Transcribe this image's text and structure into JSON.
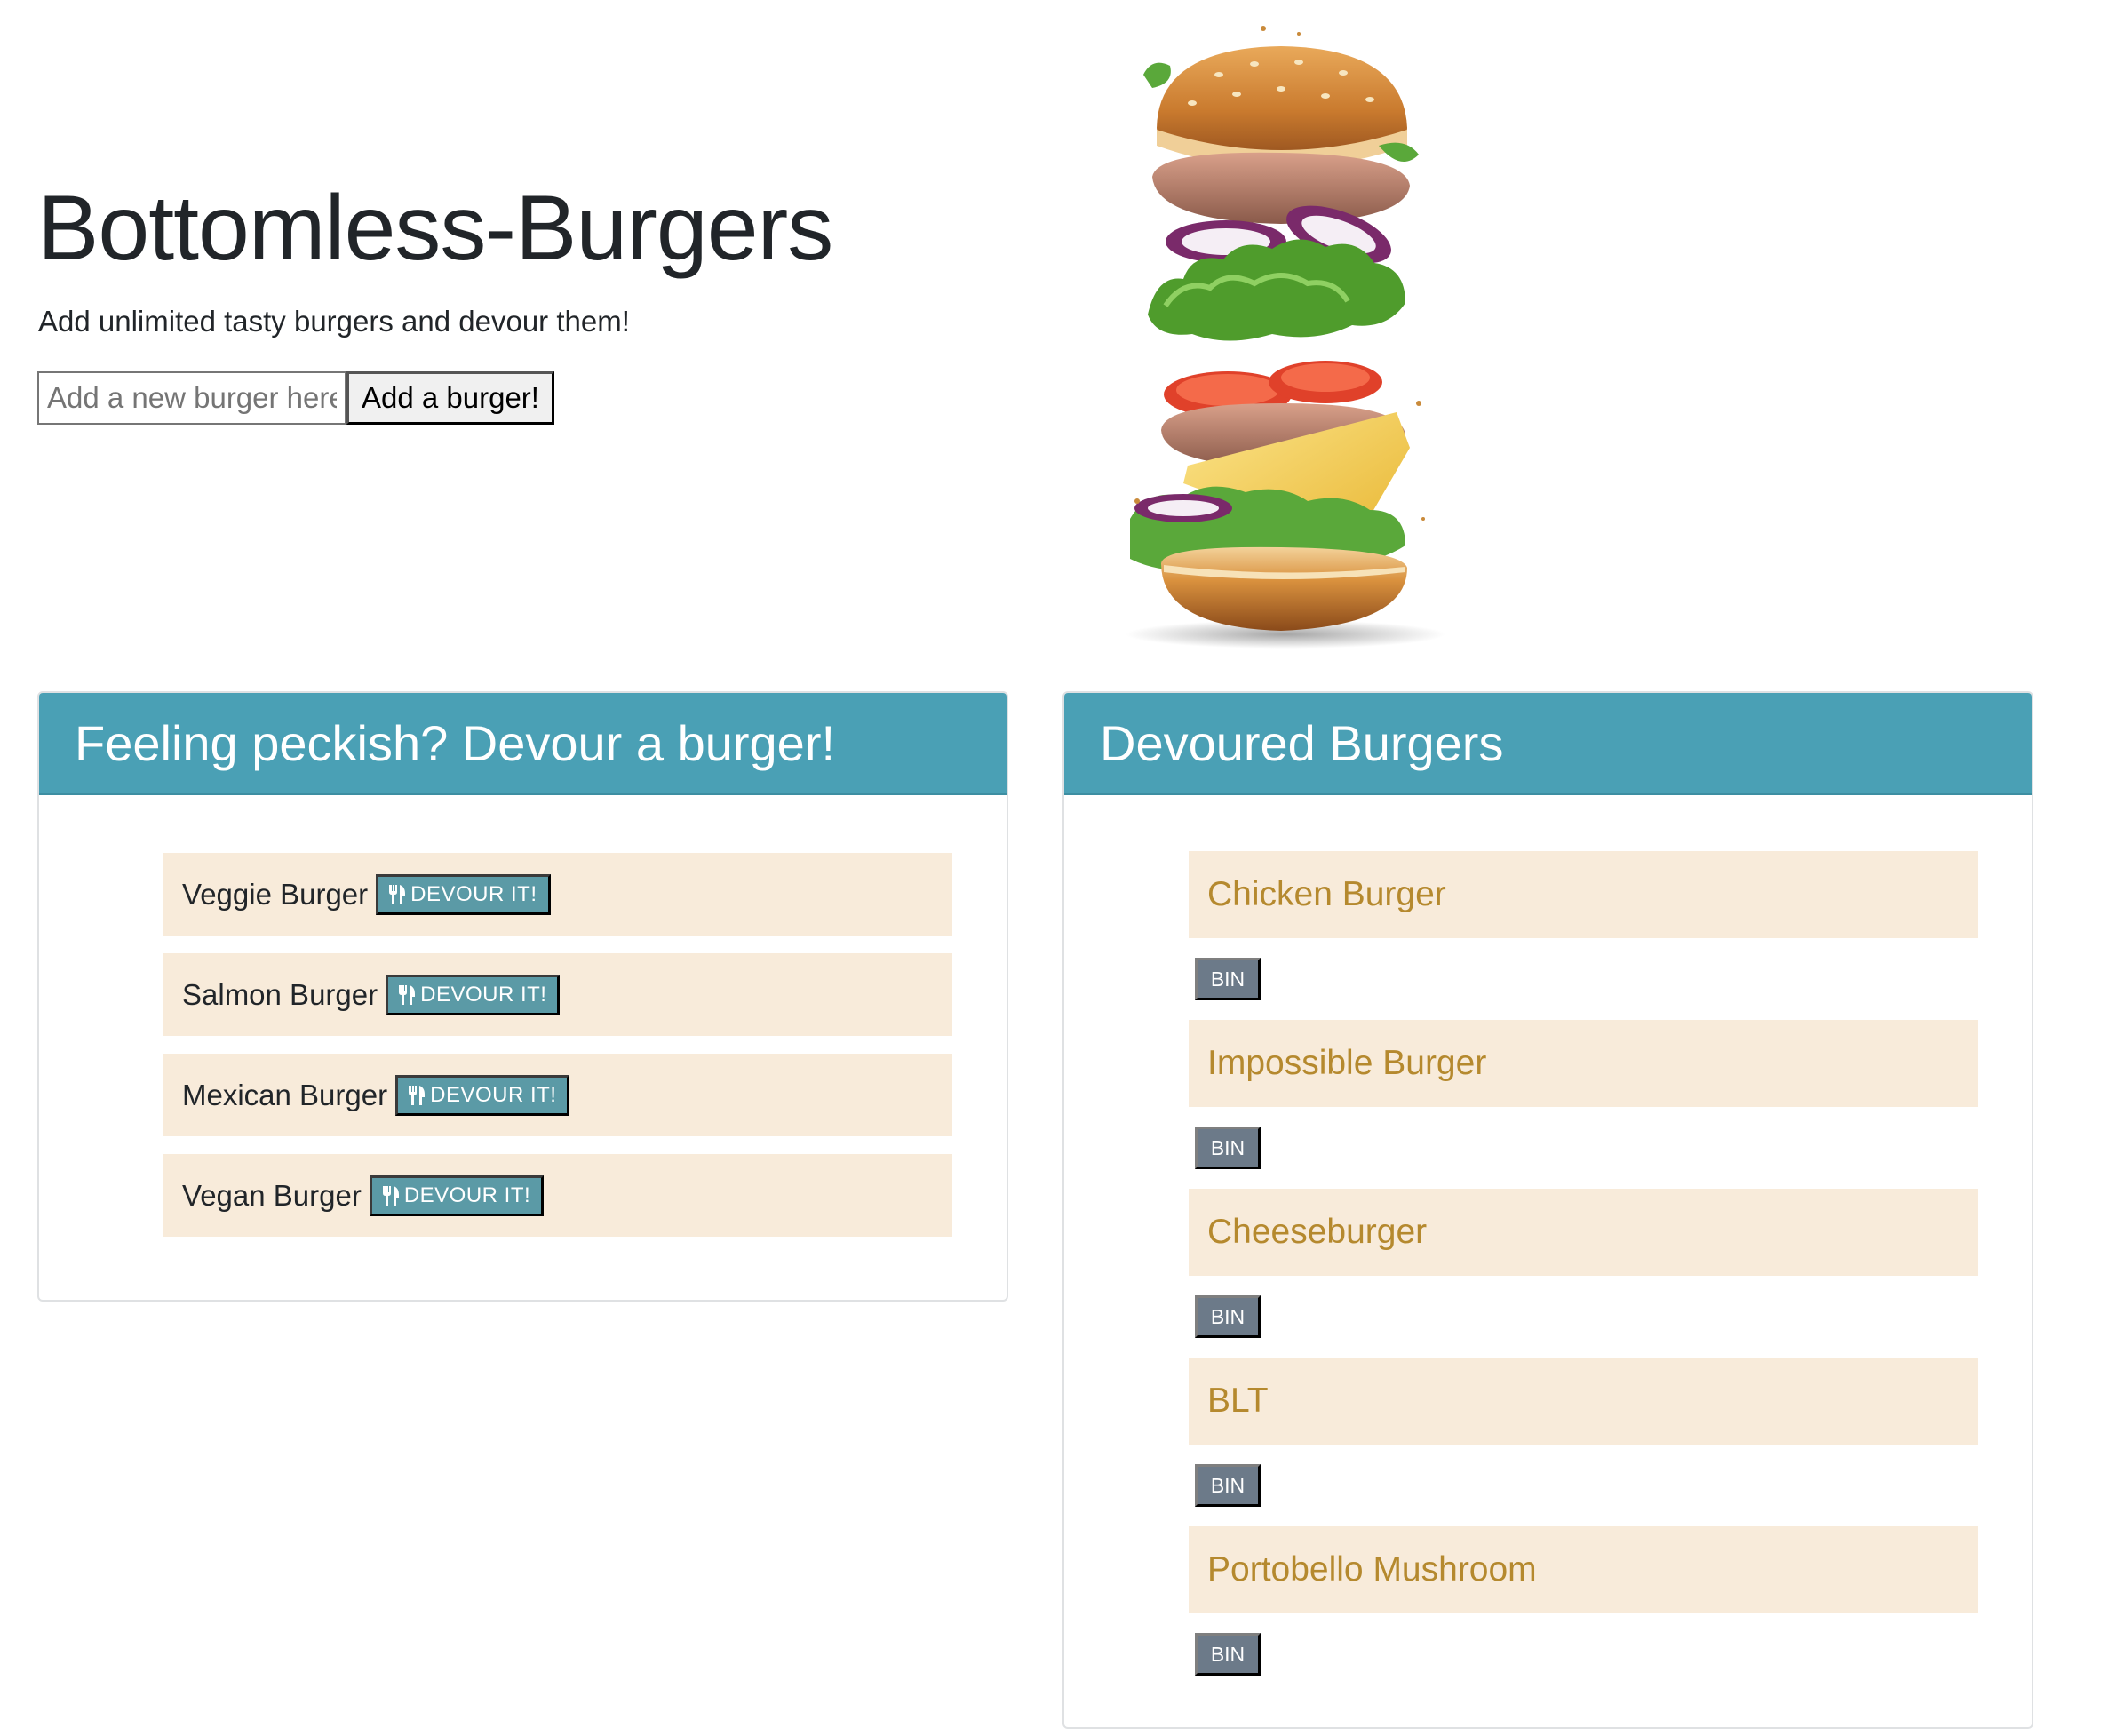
{
  "header": {
    "title": "Bottomless-Burgers",
    "tagline": "Add unlimited tasty burgers and devour them!"
  },
  "add_form": {
    "placeholder": "Add a new burger here",
    "button_label": "Add a burger!"
  },
  "hero_image": {
    "icon": "burger-illustration"
  },
  "uneaten_panel": {
    "title": "Feeling peckish? Devour a burger!",
    "button_label": "DEVOUR IT!",
    "button_icon": "utensils-icon",
    "items": [
      {
        "name": "Veggie Burger"
      },
      {
        "name": "Salmon Burger"
      },
      {
        "name": "Mexican Burger"
      },
      {
        "name": "Vegan Burger"
      }
    ]
  },
  "devoured_panel": {
    "title": "Devoured Burgers",
    "button_label": "BIN",
    "items": [
      {
        "name": "Chicken Burger"
      },
      {
        "name": "Impossible Burger"
      },
      {
        "name": "Cheeseburger"
      },
      {
        "name": "BLT"
      },
      {
        "name": "Portobello Mushroom"
      }
    ]
  },
  "colors": {
    "card_header": "#4aa0b5",
    "item_background": "#f8ebda",
    "devour_button": "#5b9aa6",
    "bin_button": "#6c7a89",
    "devoured_text": "#b5892e"
  }
}
